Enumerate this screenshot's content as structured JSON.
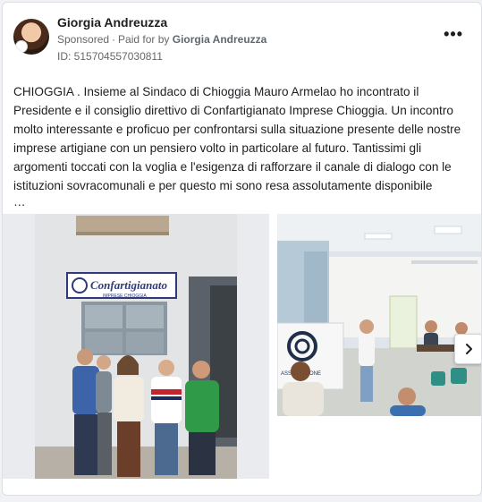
{
  "post": {
    "author": "Giorgia Andreuzza",
    "sponsored_label": "Sponsored",
    "separator": "·",
    "paid_for_prefix": "Paid for by",
    "paid_for_name": "Giorgia Andreuzza",
    "ad_id": "ID: 515704557030811",
    "more_label": "•••",
    "text": "CHIOGGIA . Insieme al Sindaco di Chioggia Mauro Armelao ho incontrato il Presidente e il consiglio direttivo di Confartigianato Imprese Chioggia. Un incontro molto interessante e proficuo per confrontarsi sulla situazione presente delle nostre imprese artigiane con un pensiero volto in particolare al futuro. Tantissimi gli argomenti toccati con la voglia e l'esigenza di rafforzare il canale di dialogo con le istituzioni sovracomunali e per questo mi sono resa assolutamente disponibile",
    "ellipsis": "…"
  },
  "media": {
    "photo1": {
      "sign_text": "Confartigianato",
      "sign_subtext": "IMPRESE CHIOGGIA"
    },
    "photo2": {
      "banner_text": "ASSOCIAZIONE"
    },
    "next_icon": "chevron-right-icon"
  }
}
